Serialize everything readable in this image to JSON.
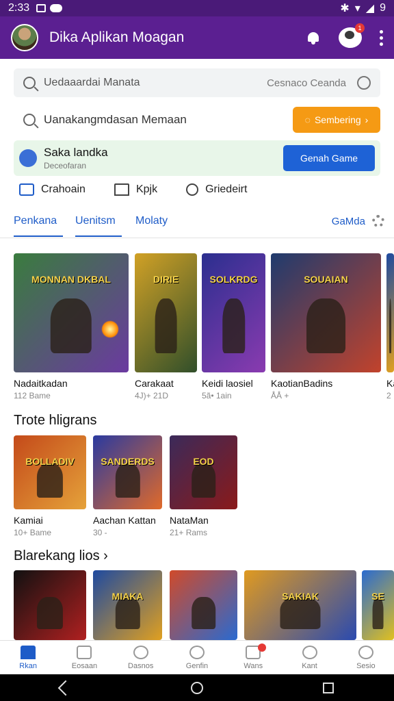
{
  "status_bar": {
    "time": "2:33",
    "battery": "9"
  },
  "app_bar": {
    "title": "Dika Aplikan Moagan",
    "notification_count": "1"
  },
  "search": {
    "placeholder": "Uedaaardai Manata",
    "hint": "Cesnaco Ceanda"
  },
  "search_row2": {
    "text": "Uanakangmdasan Memaan",
    "button_label": "Sembering"
  },
  "promo": {
    "title": "Saka landka",
    "subtitle": "Deceofaran",
    "button_label": "Genah Game"
  },
  "filters": [
    {
      "label": "Crahoain",
      "icon": "folder-icon"
    },
    {
      "label": "Kpjk",
      "icon": "tag-icon"
    },
    {
      "label": "Griedeirt",
      "icon": "search-icon"
    }
  ],
  "tabs": [
    {
      "label": "Penkana",
      "active": true
    },
    {
      "label": "Uenitsm",
      "active": true
    },
    {
      "label": "Molaty",
      "active": false
    }
  ],
  "tab_right_label": "GaMda",
  "featured": [
    {
      "title": "Nadaitkadan",
      "meta": "112 Bame",
      "art_text": "MONNAN DKBAL",
      "colors": [
        "#3a7c3e",
        "#6b3aa0"
      ]
    },
    {
      "title": "Carakaat",
      "meta": "4J)+ 21D",
      "art_text": "DIRIE",
      "colors": [
        "#d1a126",
        "#314f2a"
      ]
    },
    {
      "title": "Keidi laosiel",
      "meta": "5ã• 1ain",
      "art_text": "SOLKRDG",
      "colors": [
        "#2b2f8f",
        "#8a3bb0"
      ]
    },
    {
      "title": "KaotianBadins",
      "meta": "ÅÅ +",
      "art_text": "SOUAIAN",
      "colors": [
        "#1f3b6e",
        "#c2432c"
      ]
    },
    {
      "title": "Ka",
      "meta": "2",
      "art_text": "",
      "colors": [
        "#1e4aa0",
        "#e0a020"
      ]
    }
  ],
  "section_top": {
    "title": "Trote hligrans",
    "items": [
      {
        "title": "Kamiai",
        "meta": "10+ Bame",
        "art_text": "BOLLADIV",
        "colors": [
          "#c44a1a",
          "#e5a23a"
        ]
      },
      {
        "title": "Aachan Kattan",
        "meta": "30 -",
        "art_text": "SANDERDS",
        "colors": [
          "#2a3aa0",
          "#e06a2a"
        ]
      },
      {
        "title": "NataMan",
        "meta": "21+ Rams",
        "art_text": "EOD",
        "colors": [
          "#3b2a5a",
          "#8a1a1a"
        ]
      }
    ]
  },
  "section_bottom": {
    "title": "Blarekang lios ›",
    "items": [
      {
        "art_text": "",
        "colors": [
          "#111111",
          "#b02020"
        ]
      },
      {
        "art_text": "MIAKA",
        "colors": [
          "#1e4aa0",
          "#e0a020"
        ]
      },
      {
        "art_text": "",
        "colors": [
          "#d04a2a",
          "#2a6ad0"
        ]
      },
      {
        "art_text": "SAKIAK",
        "colors": [
          "#e09a20",
          "#2a4ab0"
        ]
      },
      {
        "art_text": "SE",
        "colors": [
          "#2a6ad0",
          "#e0c020"
        ]
      }
    ]
  },
  "bottom_nav": [
    {
      "label": "Rkan",
      "icon": "home-icon",
      "active": true
    },
    {
      "label": "Eosaan",
      "icon": "library-icon",
      "active": false
    },
    {
      "label": "Dasnos",
      "icon": "chat-icon",
      "active": false
    },
    {
      "label": "Genfin",
      "icon": "compass-icon",
      "active": false
    },
    {
      "label": "Wans",
      "icon": "message-icon",
      "active": false,
      "badge": true
    },
    {
      "label": "Kant",
      "icon": "account-icon",
      "active": false
    },
    {
      "label": "Sesio",
      "icon": "profile-icon",
      "active": false
    }
  ],
  "accent_color": "#5b1f91",
  "link_color": "#1e5cc8"
}
